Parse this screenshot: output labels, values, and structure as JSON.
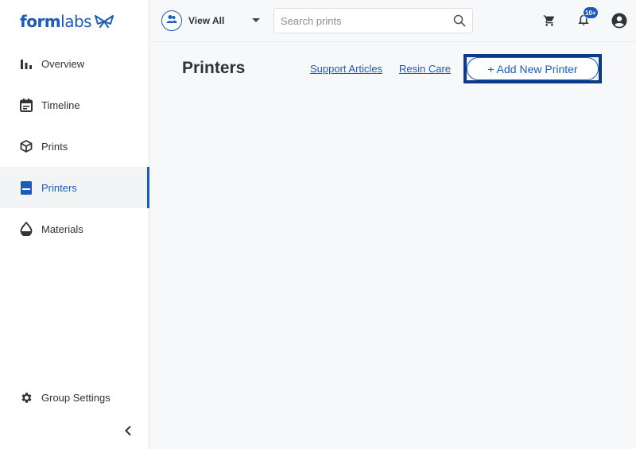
{
  "app": {
    "logo_bold": "form",
    "logo_light": "labs",
    "brand_color": "#1c5bb8"
  },
  "sidebar": {
    "items": [
      {
        "label": "Overview",
        "icon": "bar-chart-icon"
      },
      {
        "label": "Timeline",
        "icon": "calendar-icon"
      },
      {
        "label": "Prints",
        "icon": "cube-icon"
      },
      {
        "label": "Printers",
        "icon": "printer-icon",
        "active": true
      },
      {
        "label": "Materials",
        "icon": "droplet-icon"
      }
    ],
    "settings": {
      "label": "Group Settings",
      "icon": "gear-icon"
    },
    "collapse_icon": "chevron-left-icon"
  },
  "topbar": {
    "group_icon": "group-icon",
    "view_label": "View All",
    "search_placeholder": "Search prints",
    "notification_count": "10+"
  },
  "main": {
    "title": "Printers",
    "support_link": "Support Articles",
    "resin_link": "Resin Care",
    "add_button": "+ Add New Printer"
  }
}
